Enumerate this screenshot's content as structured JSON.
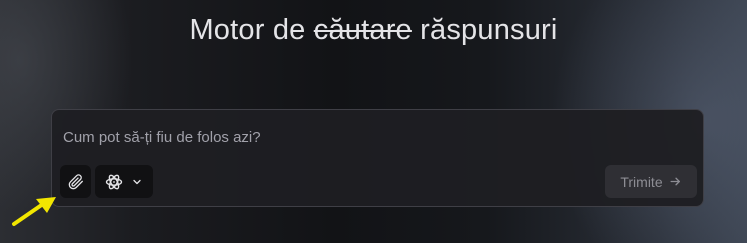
{
  "heading": {
    "before": "Motor de ",
    "struck": "căutare",
    "after": " răspunsuri"
  },
  "composer": {
    "placeholder": "Cum pot să-ți fiu de folos azi?",
    "attach_icon": "paperclip-icon",
    "model_icon": "atom-icon",
    "model_dropdown_icon": "chevron-down-icon",
    "send_label": "Trimite",
    "send_icon": "arrow-right-icon"
  },
  "annotation": {
    "pointer_icon": "arrow-pointer-icon",
    "pointer_color": "#f2e600"
  },
  "colors": {
    "text_primary": "#e4e4e7",
    "text_muted": "#a1a1aa",
    "panel_bg": "#1e1e22",
    "panel_border": "#3f3f46",
    "button_bg": "#111113",
    "send_bg": "#2f2f34"
  }
}
